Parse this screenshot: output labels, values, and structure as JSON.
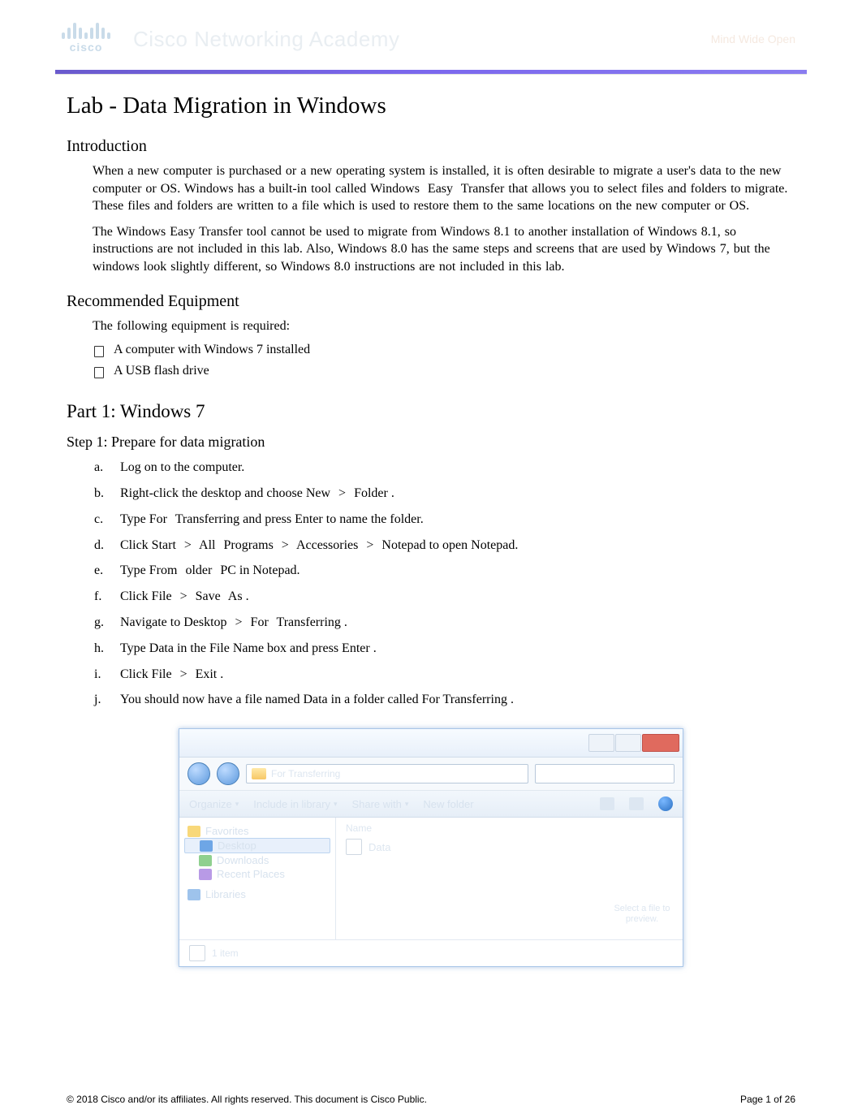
{
  "header": {
    "logo_text": "cisco",
    "academy": "Cisco Networking Academy",
    "tagline": "Mind Wide Open"
  },
  "title": "Lab - Data Migration in Windows",
  "sections": {
    "intro_heading": "Introduction",
    "intro_p1_a": "When a new computer is purchased or a new operating system is installed, it is often desirable to migrate a user's data to the new computer or OS. Windows has a built-in tool called ",
    "intro_p1_b": "Windows Easy Transfer",
    "intro_p1_c": " that allows you to select files and folders to migrate. These files and folders are written to a file which is used to restore them to the same locations on the new computer or OS.",
    "intro_p2": "The Windows Easy Transfer tool cannot be used to migrate from Windows 8.1 to another installation of Windows 8.1, so instructions are not included in this lab. Also, Windows 8.0 has the same steps and screens that are used by Windows 7, but the windows look slightly different, so Windows 8.0 instructions are not included in this lab.",
    "recequip_heading": "Recommended Equipment",
    "recequip_intro": "The following equipment is required:",
    "equip_items": [
      "A computer with Windows 7 installed",
      "A USB flash drive"
    ],
    "part1_heading": "Part 1:    Windows 7",
    "step1_heading": "Step 1:    Prepare for data migration",
    "steps": [
      {
        "m": "a.",
        "pre": "Log on to the computer.",
        "bold": "",
        "post": ""
      },
      {
        "m": "b.",
        "pre": "Right-click the desktop and choose ",
        "bold": "New > Folder",
        "post": " ."
      },
      {
        "m": "c.",
        "pre": "Type ",
        "bold": "For Transferring",
        "post": " and press Enter to name the folder."
      },
      {
        "m": "d.",
        "pre": "Click ",
        "bold": "Start > All Programs > Accessories > Notepad",
        "post": " to open Notepad."
      },
      {
        "m": "e.",
        "pre": "Type ",
        "bold": "From older PC",
        "post": " in Notepad."
      },
      {
        "m": "f.",
        "pre": "Click ",
        "bold": "File > Save As",
        "post": " ."
      },
      {
        "m": "g.",
        "pre": "Navigate to ",
        "bold": "Desktop > For Transferring",
        "post": " ."
      },
      {
        "m": "h.",
        "pre": "Type ",
        "bold": "Data",
        "post": " in the File Name box and press Enter ."
      },
      {
        "m": "i.",
        "pre": "Click ",
        "bold": "File > Exit",
        "post": " ."
      },
      {
        "m": "j.",
        "pre": "You should now have a file named ",
        "bold": "Data",
        "post": " in a folder called For Transferring ."
      }
    ]
  },
  "screenshot": {
    "addr_text": "For Transferring",
    "toolbar": {
      "organize": "Organize",
      "include": "Include in library",
      "share": "Share with",
      "newfolder": "New folder"
    },
    "nav": {
      "favorites": "Favorites",
      "desktop": "Desktop",
      "downloads": "Downloads",
      "recent": "Recent Places",
      "libraries": "Libraries"
    },
    "content": {
      "col_name": "Name",
      "file": "Data",
      "preview": "Select a file to preview."
    },
    "status": "1 item"
  },
  "footer": {
    "copyright": "© 2018 Cisco and/or its affiliates. All rights reserved. This document is Cisco Public.",
    "page": "Page  1 of 26"
  }
}
